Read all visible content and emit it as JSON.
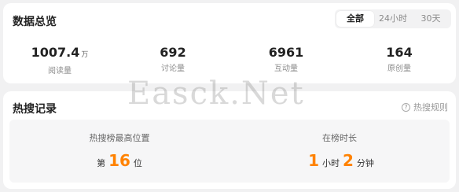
{
  "overview": {
    "title": "数据总览",
    "tabs": [
      "全部",
      "24小时",
      "30天"
    ],
    "active_tab": 0,
    "stats": [
      {
        "value": "1007.4",
        "unit": "万",
        "label": "阅读量"
      },
      {
        "value": "692",
        "unit": "",
        "label": "讨论量"
      },
      {
        "value": "6961",
        "unit": "",
        "label": "互动量"
      },
      {
        "value": "164",
        "unit": "",
        "label": "原创量"
      }
    ]
  },
  "hot_search": {
    "title": "热搜记录",
    "rules_label": "热搜规则",
    "rules_icon": "help-icon",
    "peak": {
      "label": "热搜榜最高位置",
      "prefix": "第",
      "value": "16",
      "suffix": "位"
    },
    "duration": {
      "label": "在榜时长",
      "hours": "1",
      "hours_unit": "小时",
      "minutes": "2",
      "minutes_unit": "分钟"
    }
  },
  "watermark": "Easck.Net",
  "colors": {
    "accent": "#ff8200",
    "background": "#f1f1f2",
    "card": "#ffffff"
  }
}
